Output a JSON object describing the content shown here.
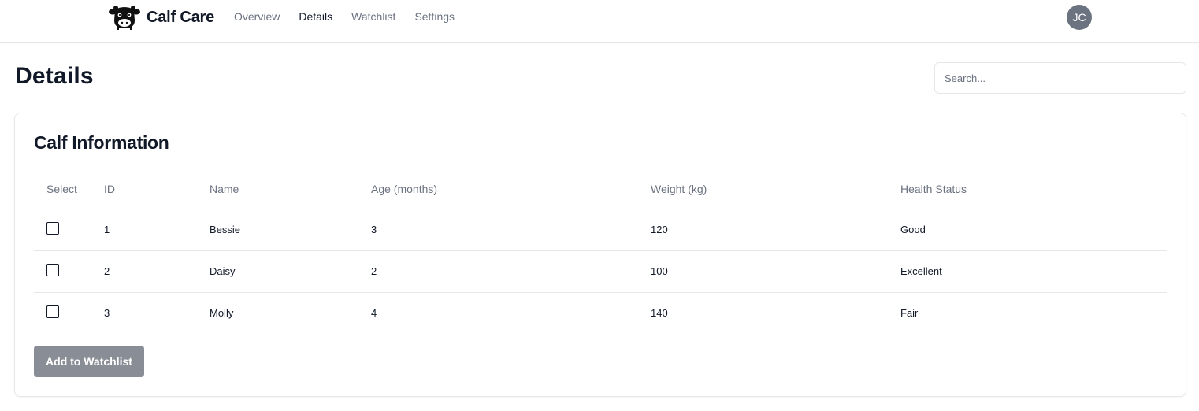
{
  "header": {
    "brand": "Calf Care",
    "logo_icon": "cow-icon",
    "nav": [
      {
        "label": "Overview",
        "active": false
      },
      {
        "label": "Details",
        "active": true
      },
      {
        "label": "Watchlist",
        "active": false
      },
      {
        "label": "Settings",
        "active": false
      }
    ],
    "avatar_initials": "JC"
  },
  "main": {
    "title": "Details",
    "search_placeholder": "Search..."
  },
  "card": {
    "title": "Calf Information",
    "columns": [
      "Select",
      "ID",
      "Name",
      "Age (months)",
      "Weight (kg)",
      "Health Status"
    ],
    "rows": [
      {
        "id": "1",
        "name": "Bessie",
        "age": "3",
        "weight": "120",
        "status": "Good",
        "selected": false
      },
      {
        "id": "2",
        "name": "Daisy",
        "age": "2",
        "weight": "100",
        "status": "Excellent",
        "selected": false
      },
      {
        "id": "3",
        "name": "Molly",
        "age": "4",
        "weight": "140",
        "status": "Fair",
        "selected": false
      }
    ],
    "button_label": "Add to Watchlist"
  },
  "colors": {
    "button_bg": "#898d95",
    "avatar_bg": "#6b7280",
    "muted_text": "#6b7280",
    "border": "#e5e7eb"
  }
}
